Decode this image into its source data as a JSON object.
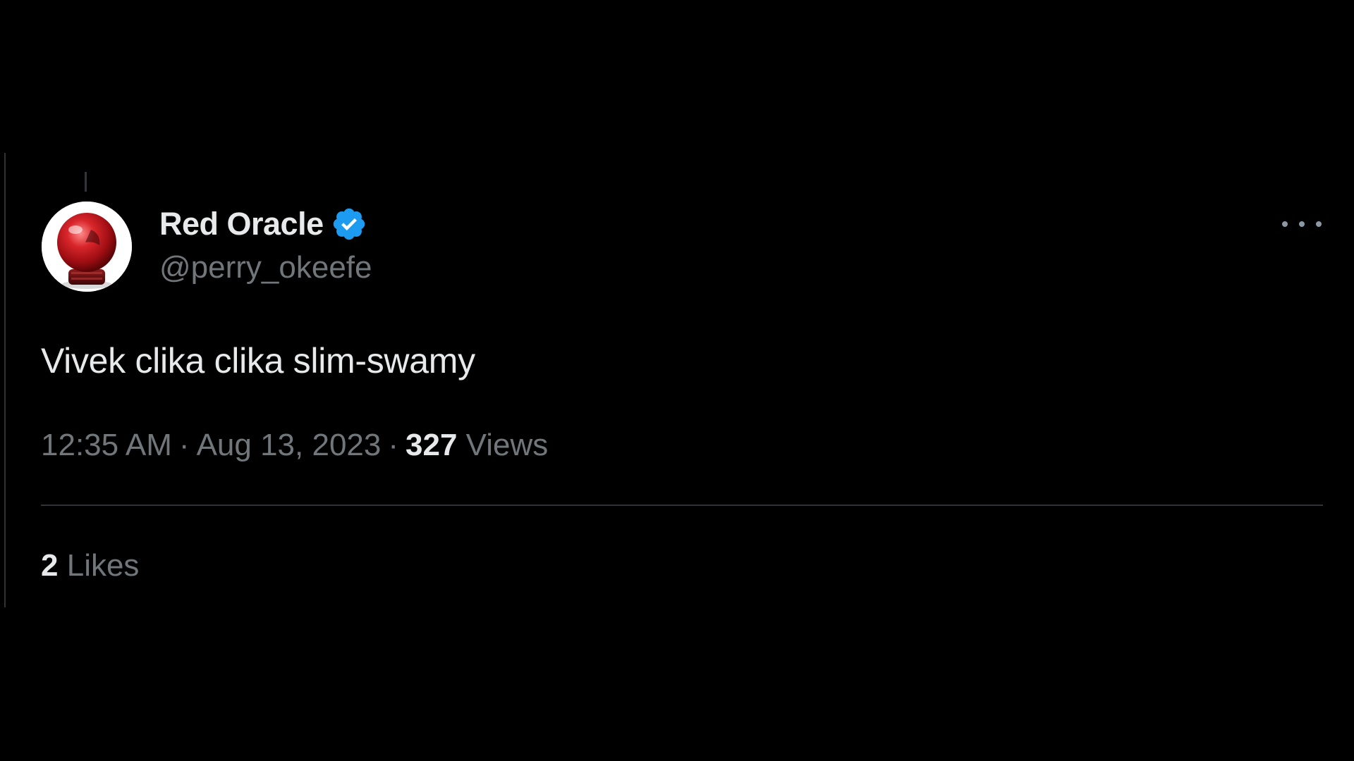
{
  "tweet": {
    "author": {
      "display_name": "Red Oracle",
      "handle": "@perry_okeefe",
      "verified": true,
      "avatar": "red-crystal-ball-avatar",
      "badge_color": "#1d9bf0"
    },
    "more_icon": "more-horizontal-icon",
    "text": "Vivek clika clika slim-swamy",
    "time": "12:35 AM",
    "separator": "·",
    "date": "Aug 13, 2023",
    "views_count": "327",
    "views_label": "Views",
    "likes_count": "2",
    "likes_label": "Likes"
  },
  "colors": {
    "background": "#000000",
    "primary_text": "#e7e9ea",
    "secondary_text": "#71767b",
    "border": "#2f3336"
  }
}
